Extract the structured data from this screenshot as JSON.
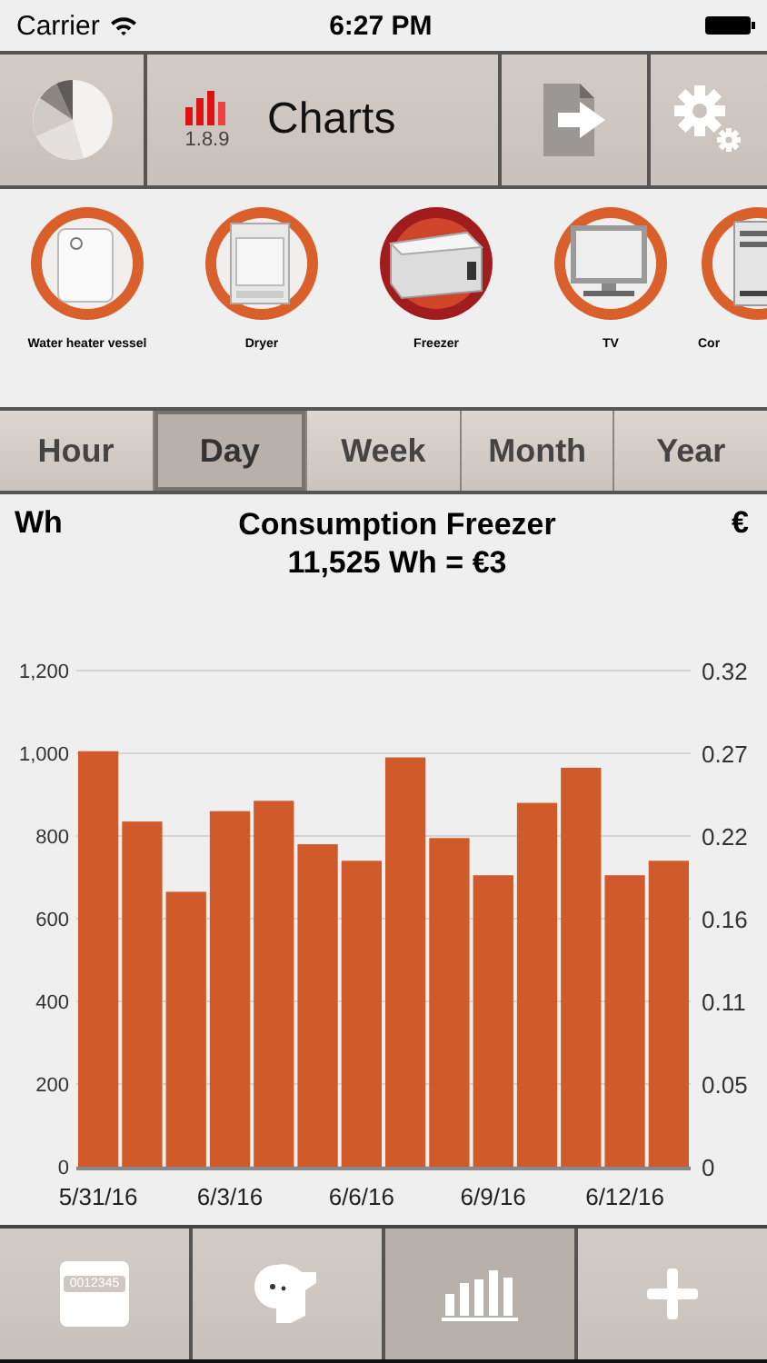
{
  "status_bar": {
    "carrier": "Carrier",
    "time": "6:27 PM"
  },
  "toolbar": {
    "version": "1.8.9",
    "title": "Charts"
  },
  "appliances": [
    {
      "kind": "water_heater",
      "label": "Water heater vessel",
      "selected": false
    },
    {
      "kind": "dryer",
      "label": "Dryer",
      "selected": false
    },
    {
      "kind": "freezer",
      "label": "Freezer",
      "selected": true
    },
    {
      "kind": "tv",
      "label": "TV",
      "selected": false
    },
    {
      "kind": "computer",
      "label": "Cor",
      "selected": false
    }
  ],
  "period_tabs": [
    {
      "label": "Hour",
      "selected": false
    },
    {
      "label": "Day",
      "selected": true
    },
    {
      "label": "Week",
      "selected": false
    },
    {
      "label": "Month",
      "selected": false
    },
    {
      "label": "Year",
      "selected": false
    }
  ],
  "chart": {
    "left_unit": "Wh",
    "right_unit": "€",
    "title": "Consumption Freezer",
    "subtitle": "11,525 Wh = €3",
    "right_axis_ticks": [
      "0.32",
      "0.27",
      "0.22",
      "0.16",
      "0.11",
      "0.05",
      "0"
    ],
    "chart_data": {
      "type": "bar",
      "ylim": [
        0,
        1200
      ],
      "grid": true,
      "categories": [
        "5/31/16",
        null,
        null,
        "6/3/16",
        null,
        null,
        "6/6/16",
        null,
        null,
        "6/9/16",
        null,
        null,
        "6/12/16",
        null
      ],
      "yticks": [
        {
          "value": 0,
          "label": "0"
        },
        {
          "value": 200,
          "label": "200"
        },
        {
          "value": 400,
          "label": "400"
        },
        {
          "value": 600,
          "label": "600"
        },
        {
          "value": 800,
          "label": "800"
        },
        {
          "value": 1000,
          "label": "1,000"
        },
        {
          "value": 1200,
          "label": "1,200"
        }
      ],
      "values": [
        1005,
        835,
        665,
        860,
        885,
        780,
        740,
        990,
        795,
        705,
        880,
        965,
        705,
        740
      ]
    }
  },
  "bottom_tabs": [
    {
      "kind": "meter",
      "text": "0012345",
      "selected": false
    },
    {
      "kind": "plug",
      "selected": false
    },
    {
      "kind": "chart",
      "selected": true
    },
    {
      "kind": "add",
      "selected": false
    }
  ]
}
